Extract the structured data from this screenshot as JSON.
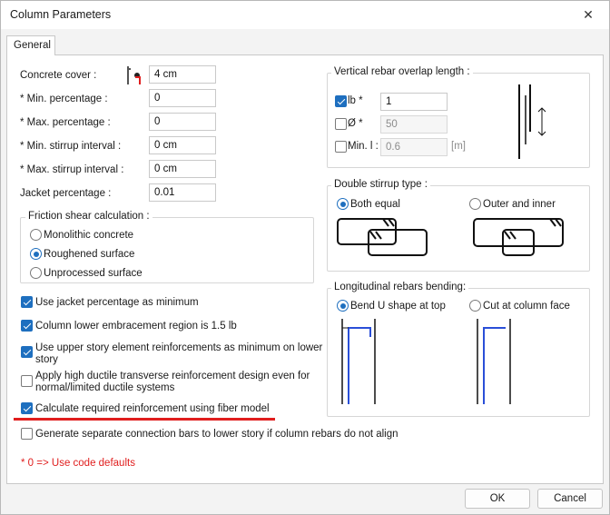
{
  "window": {
    "title": "Column Parameters",
    "close_glyph": "✕"
  },
  "tabs": [
    {
      "label": "General"
    }
  ],
  "left": {
    "concrete_cover": {
      "label": "Concrete cover :",
      "value": "4 cm",
      "icon": "cover-icon"
    },
    "min_percentage": {
      "label": "* Min. percentage :",
      "value": "0"
    },
    "max_percentage": {
      "label": "* Max. percentage :",
      "value": "0"
    },
    "min_stirrup": {
      "label": "* Min. stirrup interval :",
      "value": "0 cm"
    },
    "max_stirrup": {
      "label": "* Max. stirrup interval :",
      "value": "0 cm"
    },
    "jacket_percentage": {
      "label": "Jacket percentage :",
      "value": "0.01"
    },
    "friction": {
      "title": "Friction shear calculation :",
      "options": [
        {
          "label": "Monolithic concrete",
          "checked": false
        },
        {
          "label": "Roughened surface",
          "checked": true
        },
        {
          "label": "Unprocessed surface",
          "checked": false
        }
      ]
    },
    "checkboxes": [
      {
        "line1": "Use jacket percentage as minimum",
        "line2": "",
        "checked": true
      },
      {
        "line1": "Column lower embracement region is 1.5 lb",
        "line2": "",
        "checked": true
      },
      {
        "line1": "Use upper story element reinforcements as minimum on lower",
        "line2": "story",
        "checked": true
      },
      {
        "line1": "Apply high ductile transverse reinforcement design even for",
        "line2": "normal/limited ductile systems",
        "checked": false
      },
      {
        "line1": "Calculate required reinforcement using fiber model",
        "line2": "",
        "checked": true
      },
      {
        "line1": "Generate separate connection bars to lower story if column rebars do not align",
        "line2": "",
        "checked": false
      }
    ],
    "note": "* 0 => Use code defaults"
  },
  "overlap": {
    "title": "Vertical rebar overlap length :",
    "lb": {
      "label": "lb *",
      "value": "1",
      "checked": true
    },
    "phi": {
      "label": "Ø *",
      "value": "50",
      "checked": false
    },
    "min_l": {
      "label": "Min. l :",
      "value": "0.6",
      "unit": "[m]",
      "checked": false
    }
  },
  "double_stirrup": {
    "title": "Double stirrup type :",
    "options": [
      {
        "label": "Both equal",
        "checked": true
      },
      {
        "label": "Outer and inner",
        "checked": false
      }
    ]
  },
  "bending": {
    "title": "Longitudinal rebars bending:",
    "options": [
      {
        "label": "Bend U shape at top",
        "checked": true
      },
      {
        "label": "Cut at column face",
        "checked": false
      }
    ]
  },
  "buttons": {
    "ok": "OK",
    "cancel": "Cancel"
  },
  "colors": {
    "accent": "#1e6fbf",
    "highlight_red": "#e01e1e",
    "rebar_blue": "#2a4fd8"
  }
}
